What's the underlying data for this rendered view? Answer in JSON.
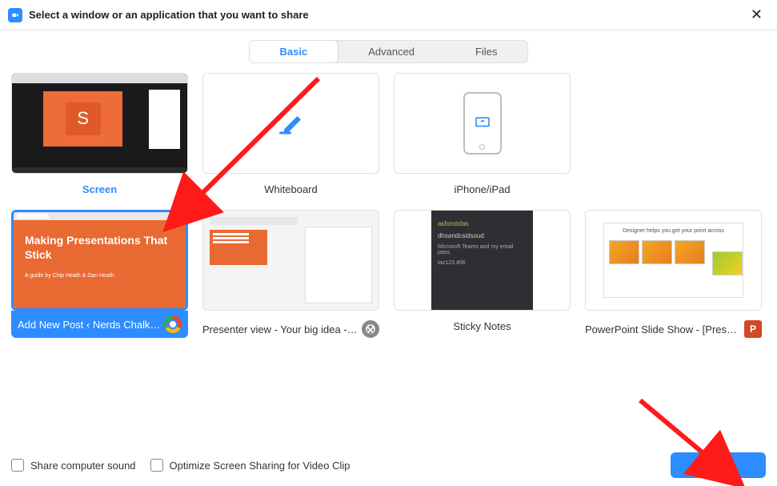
{
  "header": {
    "title": "Select a window or an application that you want to share"
  },
  "tabs": {
    "basic": "Basic",
    "advanced": "Advanced",
    "files": "Files",
    "active": "basic"
  },
  "tiles": {
    "screen": {
      "label": "Screen",
      "placeholder_letter": "S"
    },
    "whiteboard": {
      "label": "Whiteboard"
    },
    "iphone": {
      "label": "iPhone/iPad"
    },
    "chrome": {
      "label": "Add New Post ‹ Nerds Chalk — ...",
      "slide_title": "Making Presentations That Stick",
      "slide_sub": "A guide by Chip Heath & Dan Heath"
    },
    "presenter": {
      "label": "Presenter view - Your big idea - G..."
    },
    "sticky": {
      "label": "Sticky Notes",
      "line1": "asfondsfas",
      "line2": "dhsandcsidsoud",
      "line3": "Microsoft Teams and my email pass:",
      "line4": "taz123.456"
    },
    "ppt": {
      "label": "PowerPoint Slide Show - [Present...",
      "inner_title": "Designer helps you get your point across"
    }
  },
  "footer": {
    "share_sound": "Share computer sound",
    "optimize": "Optimize Screen Sharing for Video Clip",
    "share_button": "Share"
  }
}
